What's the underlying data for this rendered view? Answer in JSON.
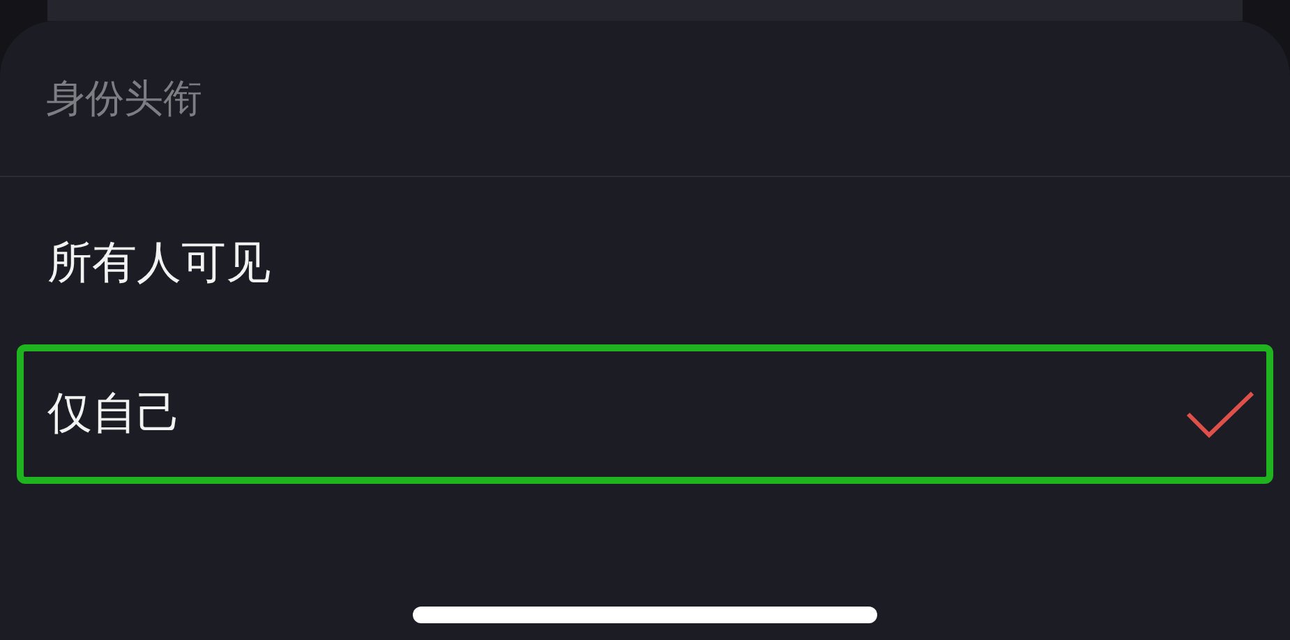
{
  "sheet": {
    "title": "身份头衔",
    "options": [
      {
        "label": "所有人可见",
        "selected": false
      },
      {
        "label": "仅自己",
        "selected": true
      }
    ]
  }
}
